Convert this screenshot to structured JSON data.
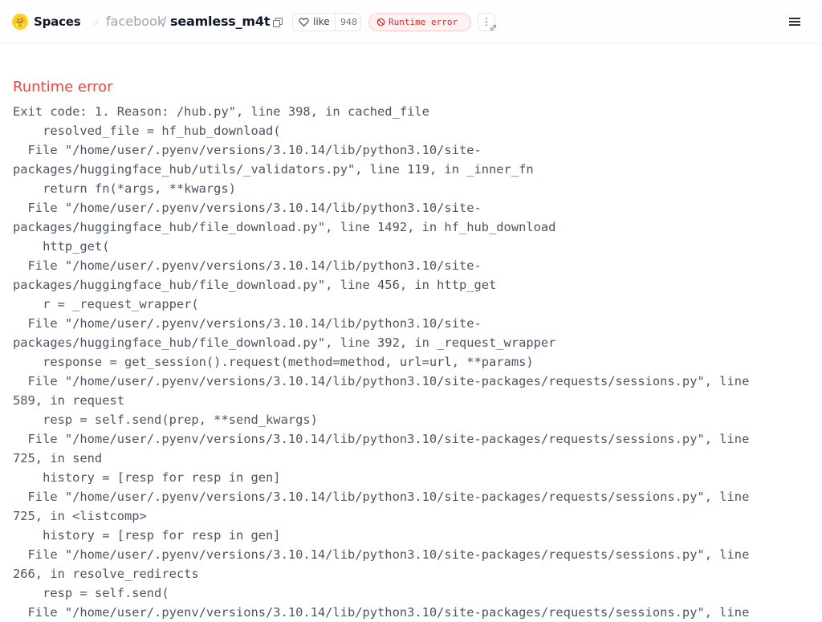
{
  "header": {
    "logo_emoji": "🤗",
    "spaces_label": "Spaces",
    "owner": "facebook",
    "separator": "/",
    "repo": "seamless_m4t",
    "like_label": "like",
    "like_count": "948",
    "status_label": "Runtime error",
    "more_label": "⋮"
  },
  "main": {
    "error_title": "Runtime error",
    "log_lines": [
      "Exit code: 1. Reason: /hub.py\", line 398, in cached_file",
      "    resolved_file = hf_hub_download(",
      "  File \"/home/user/.pyenv/versions/3.10.14/lib/python3.10/site-",
      "packages/huggingface_hub/utils/_validators.py\", line 119, in _inner_fn",
      "    return fn(*args, **kwargs)",
      "  File \"/home/user/.pyenv/versions/3.10.14/lib/python3.10/site-",
      "packages/huggingface_hub/file_download.py\", line 1492, in hf_hub_download",
      "    http_get(",
      "  File \"/home/user/.pyenv/versions/3.10.14/lib/python3.10/site-",
      "packages/huggingface_hub/file_download.py\", line 456, in http_get",
      "    r = _request_wrapper(",
      "  File \"/home/user/.pyenv/versions/3.10.14/lib/python3.10/site-",
      "packages/huggingface_hub/file_download.py\", line 392, in _request_wrapper",
      "    response = get_session().request(method=method, url=url, **params)",
      "  File \"/home/user/.pyenv/versions/3.10.14/lib/python3.10/site-packages/requests/sessions.py\", line",
      "589, in request",
      "    resp = self.send(prep, **send_kwargs)",
      "  File \"/home/user/.pyenv/versions/3.10.14/lib/python3.10/site-packages/requests/sessions.py\", line",
      "725, in send",
      "    history = [resp for resp in gen]",
      "  File \"/home/user/.pyenv/versions/3.10.14/lib/python3.10/site-packages/requests/sessions.py\", line",
      "725, in <listcomp>",
      "    history = [resp for resp in gen]",
      "  File \"/home/user/.pyenv/versions/3.10.14/lib/python3.10/site-packages/requests/sessions.py\", line",
      "266, in resolve_redirects",
      "    resp = self.send(",
      "  File \"/home/user/.pyenv/versions/3.10.14/lib/python3.10/site-packages/requests/sessions.py\", line"
    ]
  },
  "colors": {
    "error": "#ef4444",
    "badge_bg": "#fef2f2",
    "badge_text": "#dc2626",
    "log_text": "#4b5563",
    "brand_yellow": "#ffd21e"
  },
  "icons": {
    "logo": "hugging-face-logo-icon",
    "copy": "copy-icon",
    "like": "heart-icon",
    "status": "no-entry-icon",
    "more": "vertical-dots-icon",
    "link": "link-icon",
    "menu": "hamburger-menu-icon"
  }
}
